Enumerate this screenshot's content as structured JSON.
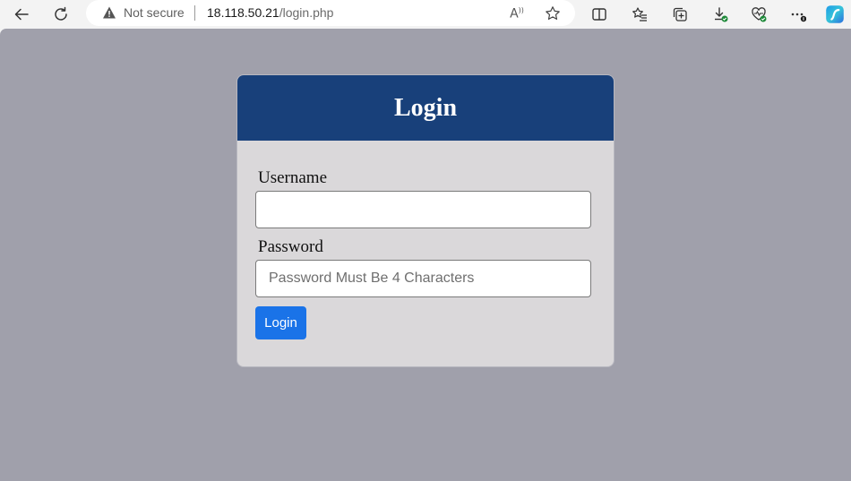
{
  "browser": {
    "address": {
      "security_label": "Not secure",
      "url_host": "18.118.50.21",
      "url_path": "/login.php"
    },
    "icons": [
      "back-icon",
      "refresh-icon",
      "warning-icon",
      "read-aloud-icon",
      "favorite-star-icon",
      "split-screen-icon",
      "favorites-icon",
      "collections-icon",
      "downloads-icon",
      "browser-essentials-icon",
      "more-icon",
      "copilot-icon"
    ]
  },
  "login": {
    "title": "Login",
    "username_label": "Username",
    "username_value": "",
    "password_label": "Password",
    "password_placeholder": "Password Must Be 4 Characters",
    "submit_label": "Login"
  },
  "colors": {
    "viewport_bg": "#a0a0ab",
    "header_bg": "#18407a",
    "card_bg": "#dad8da",
    "button_bg": "#1a73e8"
  }
}
